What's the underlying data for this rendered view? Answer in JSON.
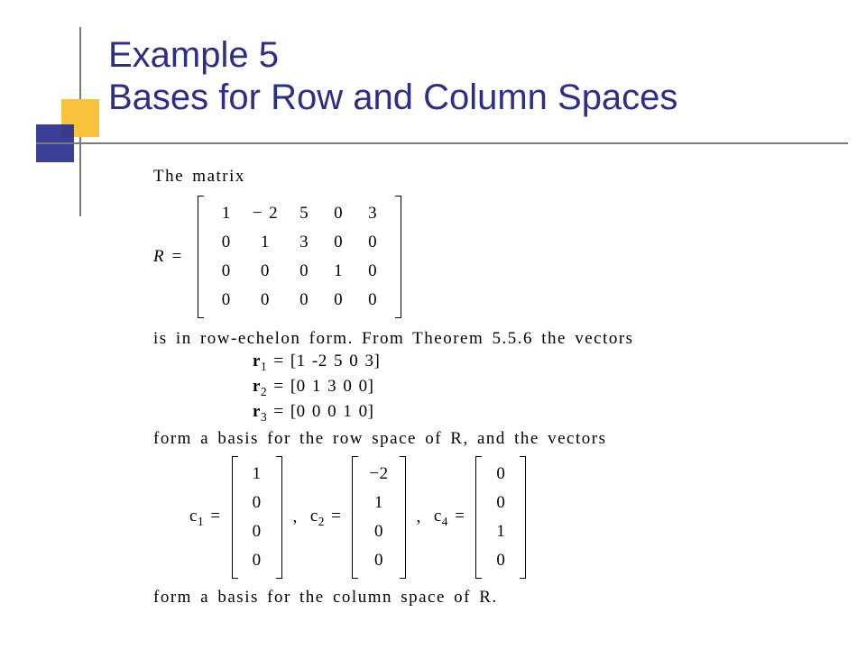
{
  "title_line1": "Example 5",
  "title_line2": "Bases for Row and Column Spaces",
  "intro": "The matrix",
  "R_label": "R =",
  "R": [
    [
      "1",
      "− 2",
      "5",
      "0",
      "3"
    ],
    [
      "0",
      "1",
      "3",
      "0",
      "0"
    ],
    [
      "0",
      "0",
      "0",
      "1",
      "0"
    ],
    [
      "0",
      "0",
      "0",
      "0",
      "0"
    ]
  ],
  "line_after_R": "is in row-echelon form. From Theorem 5.5.6 the vectors",
  "r_vectors": [
    {
      "name": "r",
      "idx": "1",
      "text": "[1 -2 5 0 3]"
    },
    {
      "name": "r",
      "idx": "2",
      "text": "[0 1 3 0 0]"
    },
    {
      "name": "r",
      "idx": "3",
      "text": "[0 0 0 1 0]"
    }
  ],
  "row_basis_line": "form a basis for the row space of R, and the vectors",
  "c_vectors": [
    {
      "name": "c",
      "idx": "1",
      "col": [
        "1",
        "0",
        "0",
        "0"
      ]
    },
    {
      "name": "c",
      "idx": "2",
      "col": [
        "−2",
        "1",
        "0",
        "0"
      ]
    },
    {
      "name": "c",
      "idx": "4",
      "col": [
        "0",
        "0",
        "1",
        "0"
      ]
    }
  ],
  "col_basis_line": "form a basis for the column space of R."
}
